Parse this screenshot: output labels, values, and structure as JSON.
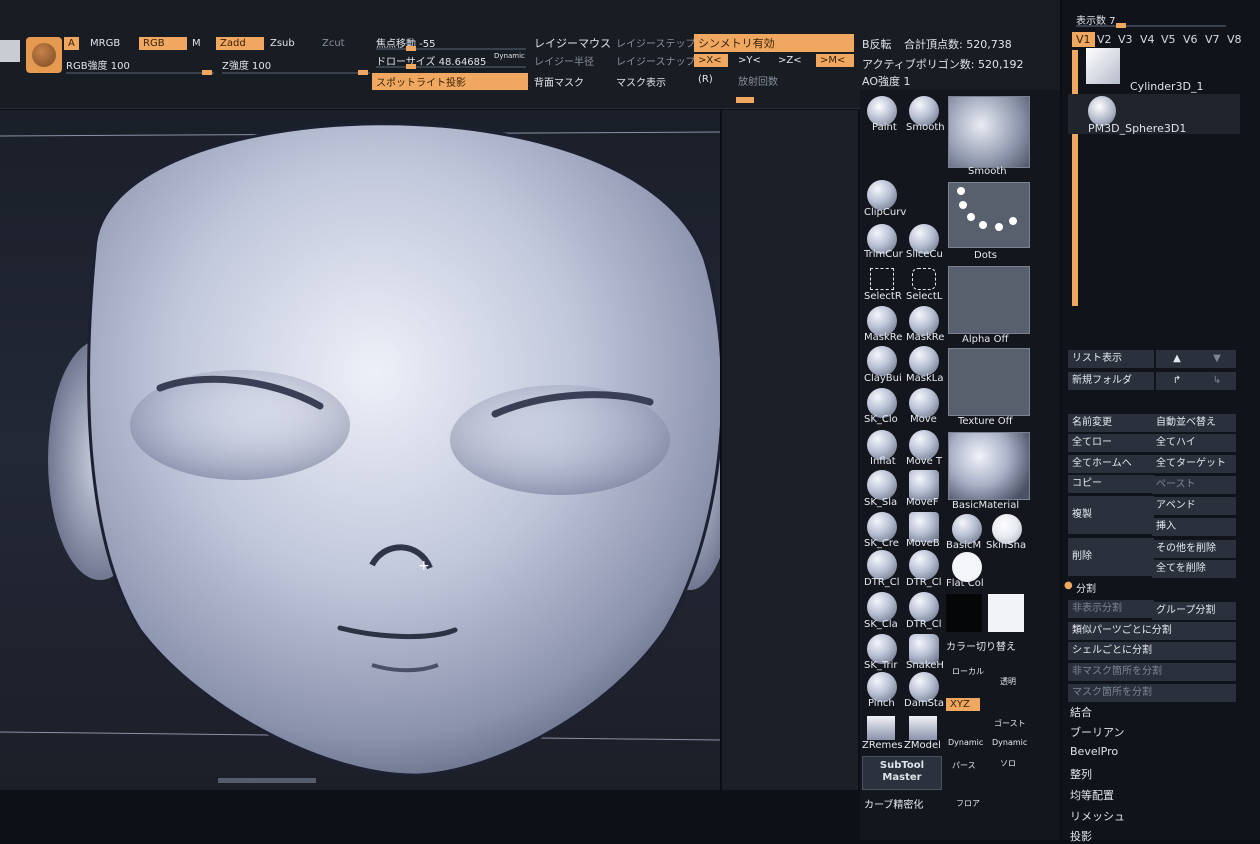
{
  "toolbar": {
    "a_label": "A",
    "mrgb_label": "MRGB",
    "rgb_label": "RGB",
    "m_label": "M",
    "zadd_label": "Zadd",
    "zsub_label": "Zsub",
    "zcut_label": "Zcut",
    "rgb_intensity": "RGB強度 100",
    "z_intensity": "Z強度 100",
    "focal_shift": "焦点移動 -55",
    "draw_size": "ドローサイズ 48.64685",
    "dynamic_label": "Dynamic",
    "spotlight": "スポットライト投影",
    "lazy_mouse": "レイジーマウス",
    "lazy_step": "レイジーステップ",
    "lazy_radius": "レイジー半径",
    "lazy_snap": "レイジースナップ",
    "backface_mask": "背面マスク",
    "mask_display": "マスク表示",
    "r_label": "(R)",
    "symmetry": "シンメトリ有効",
    "sym_x": ">X<",
    "sym_y": ">Y<",
    "sym_z": ">Z<",
    "sym_m": ">M<",
    "radial_count": "放射回数",
    "b_invert": "B反転",
    "total_points": "合計頂点数: 520,738",
    "active_polygons": "アクティブポリゴン数: 520,192",
    "ao_intensity": "AO強度 1"
  },
  "palette": {
    "brushes": [
      {
        "name": "Paint"
      },
      {
        "name": "Smooth"
      },
      {
        "name": "ClipCurv"
      },
      {
        "name": "TrimCur"
      },
      {
        "name": "SliceCu"
      },
      {
        "name": "SelectR"
      },
      {
        "name": "SelectL"
      },
      {
        "name": "MaskRe"
      },
      {
        "name": "MaskRe"
      },
      {
        "name": "ClayBui"
      },
      {
        "name": "MaskLa"
      },
      {
        "name": "SK_Clo"
      },
      {
        "name": "Move"
      },
      {
        "name": "Inflat"
      },
      {
        "name": "Move T"
      },
      {
        "name": "SK_Sla"
      },
      {
        "name": "MoveF"
      },
      {
        "name": "SK_Cre"
      },
      {
        "name": "MoveB"
      },
      {
        "name": "DTR_Cl"
      },
      {
        "name": "DTR_Cl"
      },
      {
        "name": "SK_Cla"
      },
      {
        "name": "DTR_Cl"
      },
      {
        "name": "SK_Trir"
      },
      {
        "name": "SnakeH"
      },
      {
        "name": "Pinch"
      },
      {
        "name": "DamSta"
      },
      {
        "name": "ZRemes"
      },
      {
        "name": "ZModel"
      }
    ],
    "tile_smooth": "Smooth",
    "tile_dots": "Dots",
    "tile_alpha": "Alpha Off",
    "tile_texture": "Texture Off",
    "tile_material": "BasicMaterial",
    "mat_basic": "BasicM",
    "mat_skin": "SkinSha",
    "mat_flat": "Flat Col",
    "color_switch": "カラー切り替え",
    "local_label": "ローカル",
    "transp_label": "透明",
    "xyz_label": "XYZ",
    "ghost_label": "ゴースト",
    "dynamic_a": "Dynamic",
    "dynamic_b": "Dynamic",
    "persp_label": "パース",
    "solo_label": "ソロ",
    "floor_label": "フロア",
    "subtool_master": "SubTool Master",
    "curve_label": "カーブ精密化"
  },
  "subtool": {
    "display_count": "表示数 7",
    "tabs": [
      "V1",
      "V2",
      "V3",
      "V4",
      "V5",
      "V6",
      "V7",
      "V8"
    ],
    "items": [
      {
        "name": "Cylinder3D_1"
      },
      {
        "name": "PM3D_Sphere3D1"
      }
    ],
    "list_view": "リスト表示",
    "new_folder": "新規フォルダ",
    "rename": "名前変更",
    "auto_reorder": "自動並べ替え",
    "all_low": "全てロー",
    "all_high": "全てハイ",
    "all_home": "全てホームへ",
    "all_target": "全てターゲット",
    "copy": "コピー",
    "paste": "ペースト",
    "duplicate": "複製",
    "append": "アペンド",
    "insert": "挿入",
    "delete": "削除",
    "delete_others": "その他を削除",
    "delete_all": "全てを削除",
    "split_section": "分割",
    "split_hidden": "非表示分割",
    "group_split": "グループ分割",
    "split_similar": "類似パーツごとに分割",
    "split_shell": "シェルごとに分割",
    "split_unmasked": "非マスク箇所を分割",
    "split_masked": "マスク箇所を分割",
    "merge": "結合",
    "boolean": "ブーリアン",
    "bevelpro": "BevelPro",
    "align": "整列",
    "distribute": "均等配置",
    "remesh": "リメッシュ",
    "project": "投影"
  },
  "colors": {
    "accent": "#f0a860",
    "panel": "#13161c",
    "model": "#b9c1d6"
  }
}
